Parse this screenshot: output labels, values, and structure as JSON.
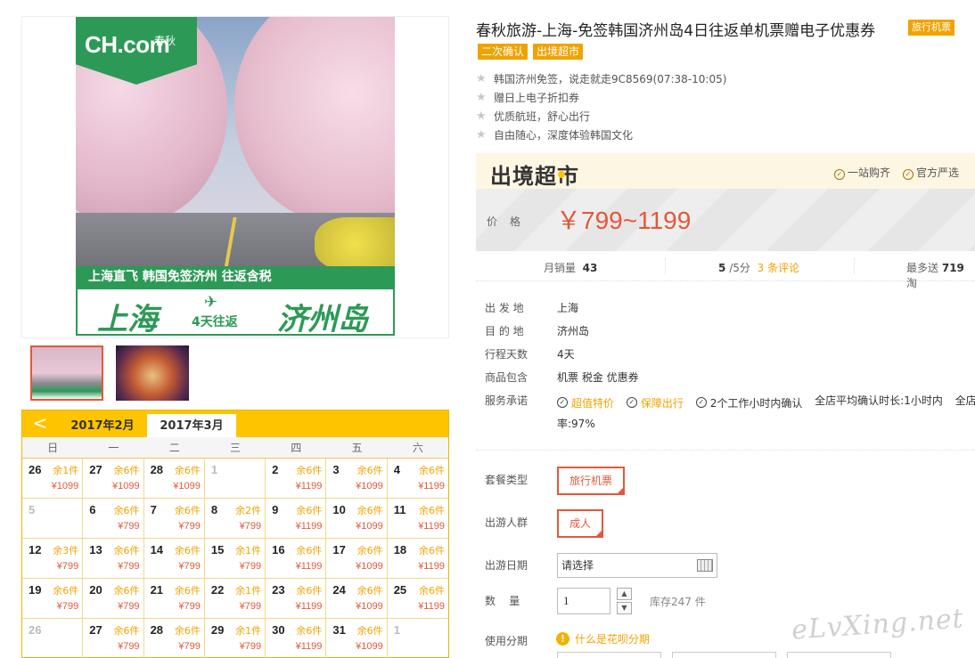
{
  "product": {
    "title": "春秋旅游-上海-免签韩国济州岛4日往返单机票赠电子优惠券",
    "title_tag": "旅行机票",
    "tags": [
      "二次确认",
      "出境超市"
    ],
    "features": [
      "韩国济州免签，说走就走9C8569(07:38-10:05)",
      "赠日上电子折扣券",
      "优质航班，舒心出行",
      "自由随心，深度体验韩国文化"
    ]
  },
  "image": {
    "logo_text": "CH.com",
    "logo_sub": "春秋",
    "banner_top": "上海直飞  韩国免签济州  往返含税",
    "banner_from": "上海",
    "banner_days": "4天往返",
    "banner_to": "济州岛"
  },
  "supermarket": {
    "logo": "出境超市",
    "badges": [
      "一站购齐",
      "官方严选"
    ],
    "price_label": "价格",
    "price": "￥799~1199"
  },
  "stats": {
    "monthly_sales_label": "月销量",
    "monthly_sales": "43",
    "rating": "5",
    "rating_suffix": "/5分",
    "reviews": "3 条评论",
    "points_label": "最多送",
    "points": "719",
    "points_suffix": "淘"
  },
  "info": [
    {
      "label": "出 发 地",
      "value": "上海"
    },
    {
      "label": "目 的 地",
      "value": "济州岛"
    },
    {
      "label": "行程天数",
      "value": "4天"
    },
    {
      "label": "商品包含",
      "value": "机票  税金  优惠券"
    }
  ],
  "service": {
    "label": "服务承诺",
    "items": [
      "超值特价",
      "保障出行",
      "2个工作小时内确认"
    ],
    "confirm_time": "全店平均确认时长:1小时内",
    "rate_prefix": "全店",
    "rate_line2": "率:97%"
  },
  "options": {
    "package_label": "套餐类型",
    "package_value": "旅行机票",
    "crowd_label": "出游人群",
    "crowd_value": "成人",
    "date_label": "出游日期",
    "date_placeholder": "请选择",
    "qty_label": "数    量",
    "qty_value": "1",
    "stock": "库存247 件",
    "installment_label": "使用分期",
    "installment_link": "什么是花呗分期"
  },
  "calendar": {
    "prev_icon": "<",
    "tabs": [
      "2017年2月",
      "2017年3月"
    ],
    "weekdays": [
      "日",
      "一",
      "二",
      "三",
      "四",
      "五",
      "六"
    ],
    "rows": [
      [
        {
          "d": "26",
          "s": "余1件",
          "p": "¥1099"
        },
        {
          "d": "27",
          "s": "余6件",
          "p": "¥1099"
        },
        {
          "d": "28",
          "s": "余6件",
          "p": "¥1099"
        },
        {
          "d": "1",
          "s": "",
          "p": "",
          "gray": true
        },
        {
          "d": "2",
          "s": "余6件",
          "p": "¥1199"
        },
        {
          "d": "3",
          "s": "余6件",
          "p": "¥1099"
        },
        {
          "d": "4",
          "s": "余6件",
          "p": "¥1199"
        }
      ],
      [
        {
          "d": "5",
          "s": "",
          "p": "",
          "gray": true
        },
        {
          "d": "6",
          "s": "余6件",
          "p": "¥799"
        },
        {
          "d": "7",
          "s": "余6件",
          "p": "¥799"
        },
        {
          "d": "8",
          "s": "余2件",
          "p": "¥799"
        },
        {
          "d": "9",
          "s": "余6件",
          "p": "¥1199"
        },
        {
          "d": "10",
          "s": "余6件",
          "p": "¥1099"
        },
        {
          "d": "11",
          "s": "余6件",
          "p": "¥1199"
        }
      ],
      [
        {
          "d": "12",
          "s": "余3件",
          "p": "¥799"
        },
        {
          "d": "13",
          "s": "余6件",
          "p": "¥799"
        },
        {
          "d": "14",
          "s": "余6件",
          "p": "¥799"
        },
        {
          "d": "15",
          "s": "余1件",
          "p": "¥799"
        },
        {
          "d": "16",
          "s": "余6件",
          "p": "¥1199"
        },
        {
          "d": "17",
          "s": "余6件",
          "p": "¥1099"
        },
        {
          "d": "18",
          "s": "余6件",
          "p": "¥1199"
        }
      ],
      [
        {
          "d": "19",
          "s": "余6件",
          "p": "¥799"
        },
        {
          "d": "20",
          "s": "余6件",
          "p": "¥799"
        },
        {
          "d": "21",
          "s": "余6件",
          "p": "¥799"
        },
        {
          "d": "22",
          "s": "余1件",
          "p": "¥799"
        },
        {
          "d": "23",
          "s": "余6件",
          "p": "¥1199"
        },
        {
          "d": "24",
          "s": "余6件",
          "p": "¥1099"
        },
        {
          "d": "25",
          "s": "余6件",
          "p": "¥1199"
        }
      ],
      [
        {
          "d": "26",
          "s": "",
          "p": "",
          "gray": true
        },
        {
          "d": "27",
          "s": "余6件",
          "p": "¥799"
        },
        {
          "d": "28",
          "s": "余6件",
          "p": "¥799"
        },
        {
          "d": "29",
          "s": "余1件",
          "p": "¥799"
        },
        {
          "d": "30",
          "s": "余6件",
          "p": "¥1199"
        },
        {
          "d": "31",
          "s": "余6件",
          "p": "¥1099"
        },
        {
          "d": "1",
          "s": "",
          "p": "",
          "gray": true
        }
      ]
    ]
  },
  "watermark": "eLvXing.net"
}
